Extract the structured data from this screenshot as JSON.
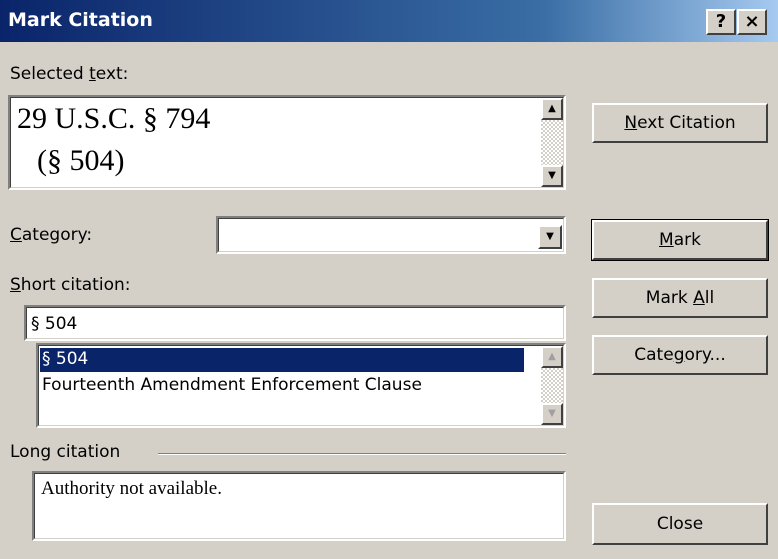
{
  "window": {
    "title": "Mark Citation",
    "help_label": "?",
    "close_label": "×"
  },
  "selected_text": {
    "label_prefix": "Selected ",
    "label_key": "t",
    "label_suffix": "ext:",
    "line1": "29 U.S.C. § 794",
    "line2": "(§ 504)"
  },
  "category": {
    "label_key": "C",
    "label_suffix": "ategory:",
    "value": ""
  },
  "short_citation": {
    "label_key": "S",
    "label_suffix": "hort citation:",
    "value": "§ 504",
    "items": [
      "§ 504",
      "Fourteenth Amendment Enforcement Clause"
    ]
  },
  "long_citation": {
    "label": "Long citation",
    "value": "Authority not available."
  },
  "buttons": {
    "next_citation": {
      "key": "N",
      "rest": "ext Citation"
    },
    "mark": {
      "key": "M",
      "rest": "ark"
    },
    "mark_all": {
      "pre": "Mark ",
      "key": "A",
      "rest": "ll"
    },
    "category": {
      "pre": "Cate",
      "key": "g",
      "rest": "ory..."
    },
    "close": "Close"
  },
  "colors": {
    "title_start": "#0a246a",
    "title_end": "#a6caf0",
    "selection": "#0a246a",
    "face": "#d4d0c8"
  },
  "icons": {
    "scroll_up": "triangle-up",
    "scroll_down": "triangle-down",
    "dropdown": "triangle-down"
  }
}
